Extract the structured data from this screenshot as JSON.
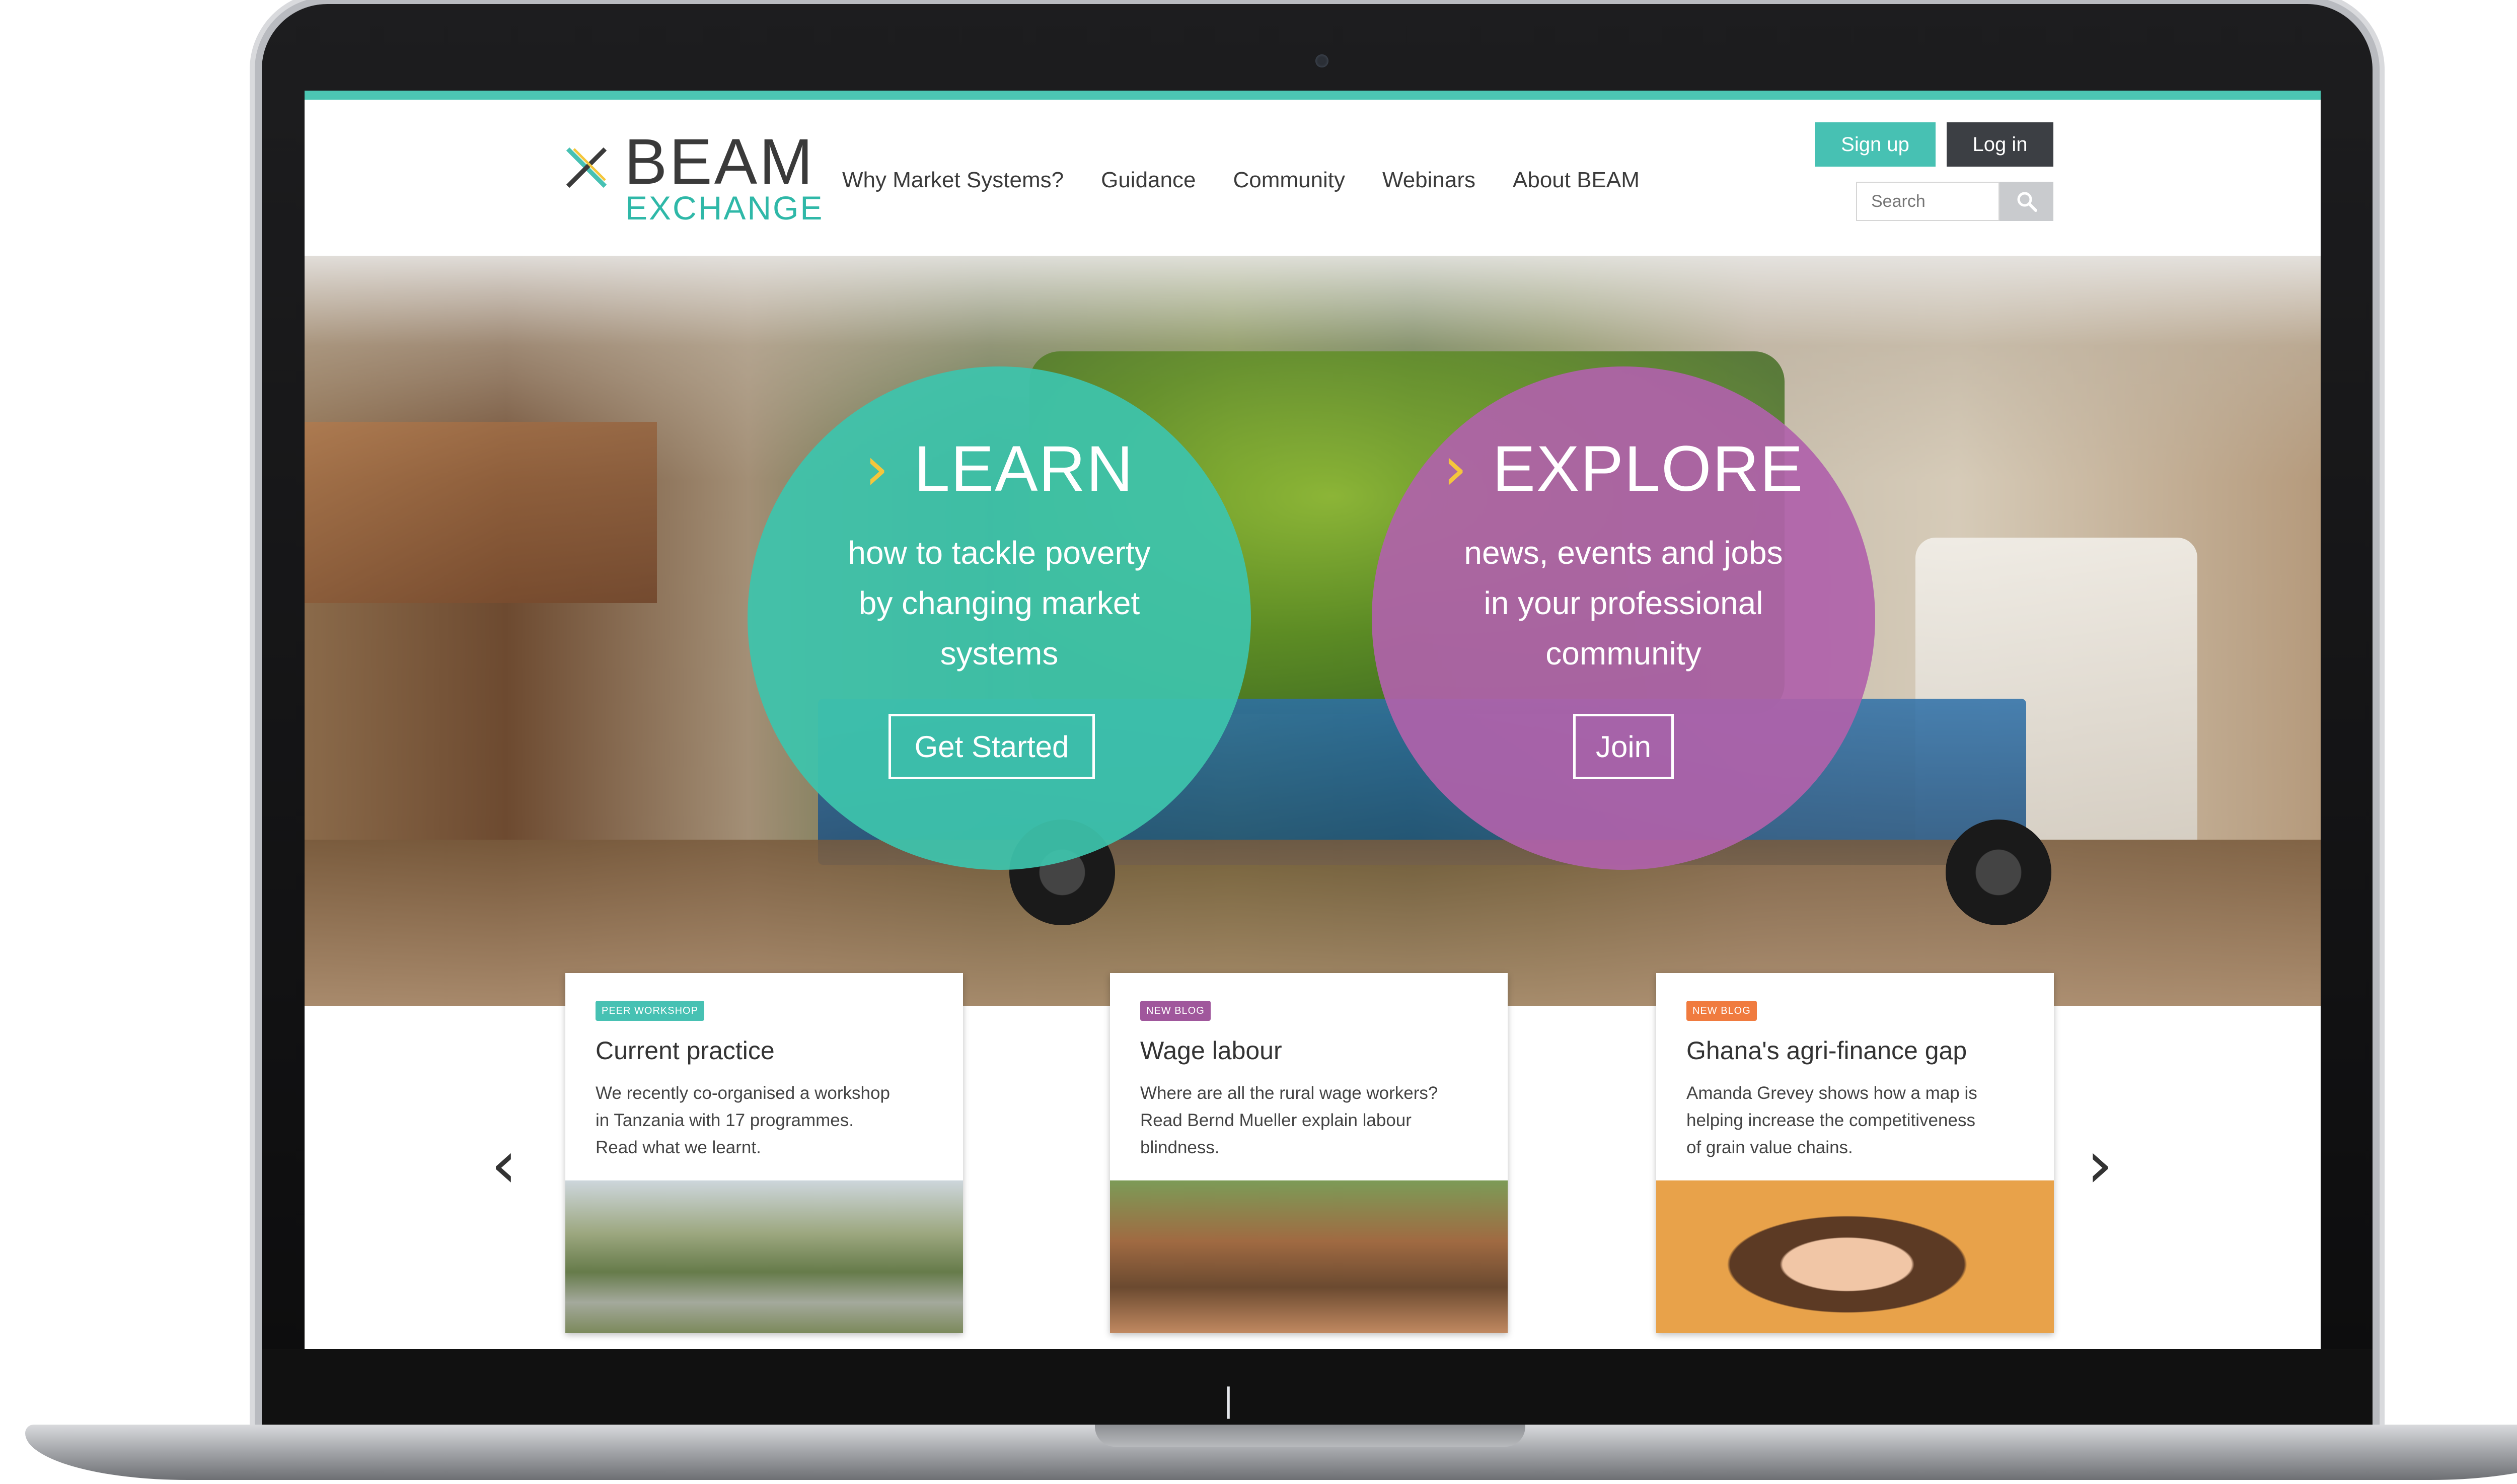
{
  "logo": {
    "line1": "BEAM",
    "line2": "EXCHANGE"
  },
  "nav": [
    {
      "label": "Why Market Systems?"
    },
    {
      "label": "Guidance"
    },
    {
      "label": "Community"
    },
    {
      "label": "Webinars"
    },
    {
      "label": "About BEAM"
    }
  ],
  "auth": {
    "signup_label": "Sign up",
    "login_label": "Log in"
  },
  "search": {
    "placeholder": "Search"
  },
  "hero": {
    "learn": {
      "heading": "LEARN",
      "body": [
        "how to tackle poverty",
        "by changing market",
        "systems"
      ],
      "button": "Get Started"
    },
    "explore": {
      "heading": "EXPLORE",
      "body": [
        "news, events and jobs",
        "in your professional",
        "community"
      ],
      "button": "Join"
    }
  },
  "cards": [
    {
      "badge": "PEER WORKSHOP",
      "title": "Current practice",
      "text": [
        "We recently co-organised a workshop",
        "in Tanzania with 17 programmes.",
        "Read what we learnt."
      ]
    },
    {
      "badge": "NEW BLOG",
      "title": "Wage labour",
      "text": [
        "Where are all the rural wage workers?",
        "Read Bernd Mueller explain labour",
        "blindness."
      ]
    },
    {
      "badge": "NEW BLOG",
      "title": "Ghana's agri-finance gap",
      "text": [
        "Amanda Grevey shows how a map is",
        "helping increase the competitiveness",
        "of grain value chains."
      ]
    }
  ],
  "colors": {
    "teal": "#47c1b3",
    "purple": "#b062aa",
    "orange": "#f07b3f",
    "chevron": "#f4c63c"
  },
  "icons": {
    "logo": "beam-x-icon",
    "search": "search-icon",
    "prev": "chevron-left-icon",
    "next": "chevron-right-icon"
  }
}
